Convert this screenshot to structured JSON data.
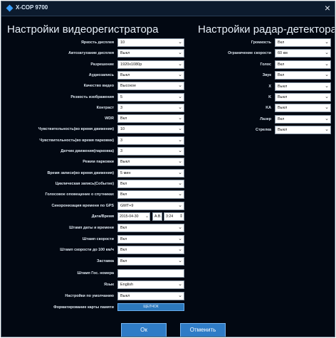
{
  "window": {
    "title": "X-COP 9700",
    "close_glyph": "×"
  },
  "dvr": {
    "title": "Настройки видеорегистратора",
    "settings": [
      {
        "label": "Яркость дисплея",
        "value": "10"
      },
      {
        "label": "Автозатухание дисплея",
        "value": "Выкл"
      },
      {
        "label": "Разрешение",
        "value": "1920x1080p"
      },
      {
        "label": "Аудиозапись",
        "value": "Выкл"
      },
      {
        "label": "Качество видео",
        "value": "Высокое"
      },
      {
        "label": "Резкость изображения",
        "value": "5"
      },
      {
        "label": "Контраст",
        "value": "3"
      },
      {
        "label": "WDR",
        "value": "Вкл"
      },
      {
        "label": "Чувствительность(во время движения)",
        "value": "10"
      },
      {
        "label": "Чувствительность(во время парковки)",
        "value": "3"
      },
      {
        "label": "Датчик движения(парковка)",
        "value": "3"
      },
      {
        "label": "Режим парковки",
        "value": "Выкл"
      },
      {
        "label": "Время записи(во время движения)",
        "value": "5 мин"
      },
      {
        "label": "Циклическая запись(Событие)",
        "value": "Вкл"
      },
      {
        "label": "Голосовое оповещение о спутниках",
        "value": "Вкл"
      },
      {
        "label": "Синхронизация времени по GPS",
        "value": "GMT+9"
      }
    ],
    "datetime": {
      "label": "Дата/Время",
      "date_value": "2015-04-30",
      "ampm_value": "А.В.",
      "time_value": "3:24"
    },
    "settings2": [
      {
        "label": "Штамп даты и времени",
        "value": "Вкл"
      },
      {
        "label": "Штамп скорости",
        "value": "Вкл"
      },
      {
        "label": "Штамп скорости до 100 км/ч",
        "value": "Вкл"
      },
      {
        "label": "Заставка",
        "value": "Вкл"
      }
    ],
    "plate": {
      "label": "Штамп Гос. номера",
      "value": ""
    },
    "settings3": [
      {
        "label": "Язык",
        "value": "English"
      },
      {
        "label": "Настройки по умолчанию",
        "value": "Выкл"
      }
    ],
    "format": {
      "label": "Форматирование карты памяти",
      "button": "ЩЕЛЧОК"
    }
  },
  "radar": {
    "title": "Настройки радар-детектора",
    "settings": [
      {
        "label": "Громкость",
        "value": "Вкл"
      },
      {
        "label": "Ограничение скорости",
        "value": "60 км"
      },
      {
        "label": "Голос",
        "value": "Вкл"
      },
      {
        "label": "Звук",
        "value": "Вкл"
      },
      {
        "label": "X",
        "value": "Выкл"
      },
      {
        "label": "K",
        "value": "Выкл"
      },
      {
        "label": "KA",
        "value": "Выкл"
      },
      {
        "label": "Лазер",
        "value": "Вкл"
      },
      {
        "label": "Стрелка",
        "value": "Выкл"
      }
    ]
  },
  "footer": {
    "ok_label": "Ок",
    "cancel_label": "Отменить"
  },
  "icons": {
    "chevron": "⌄"
  }
}
